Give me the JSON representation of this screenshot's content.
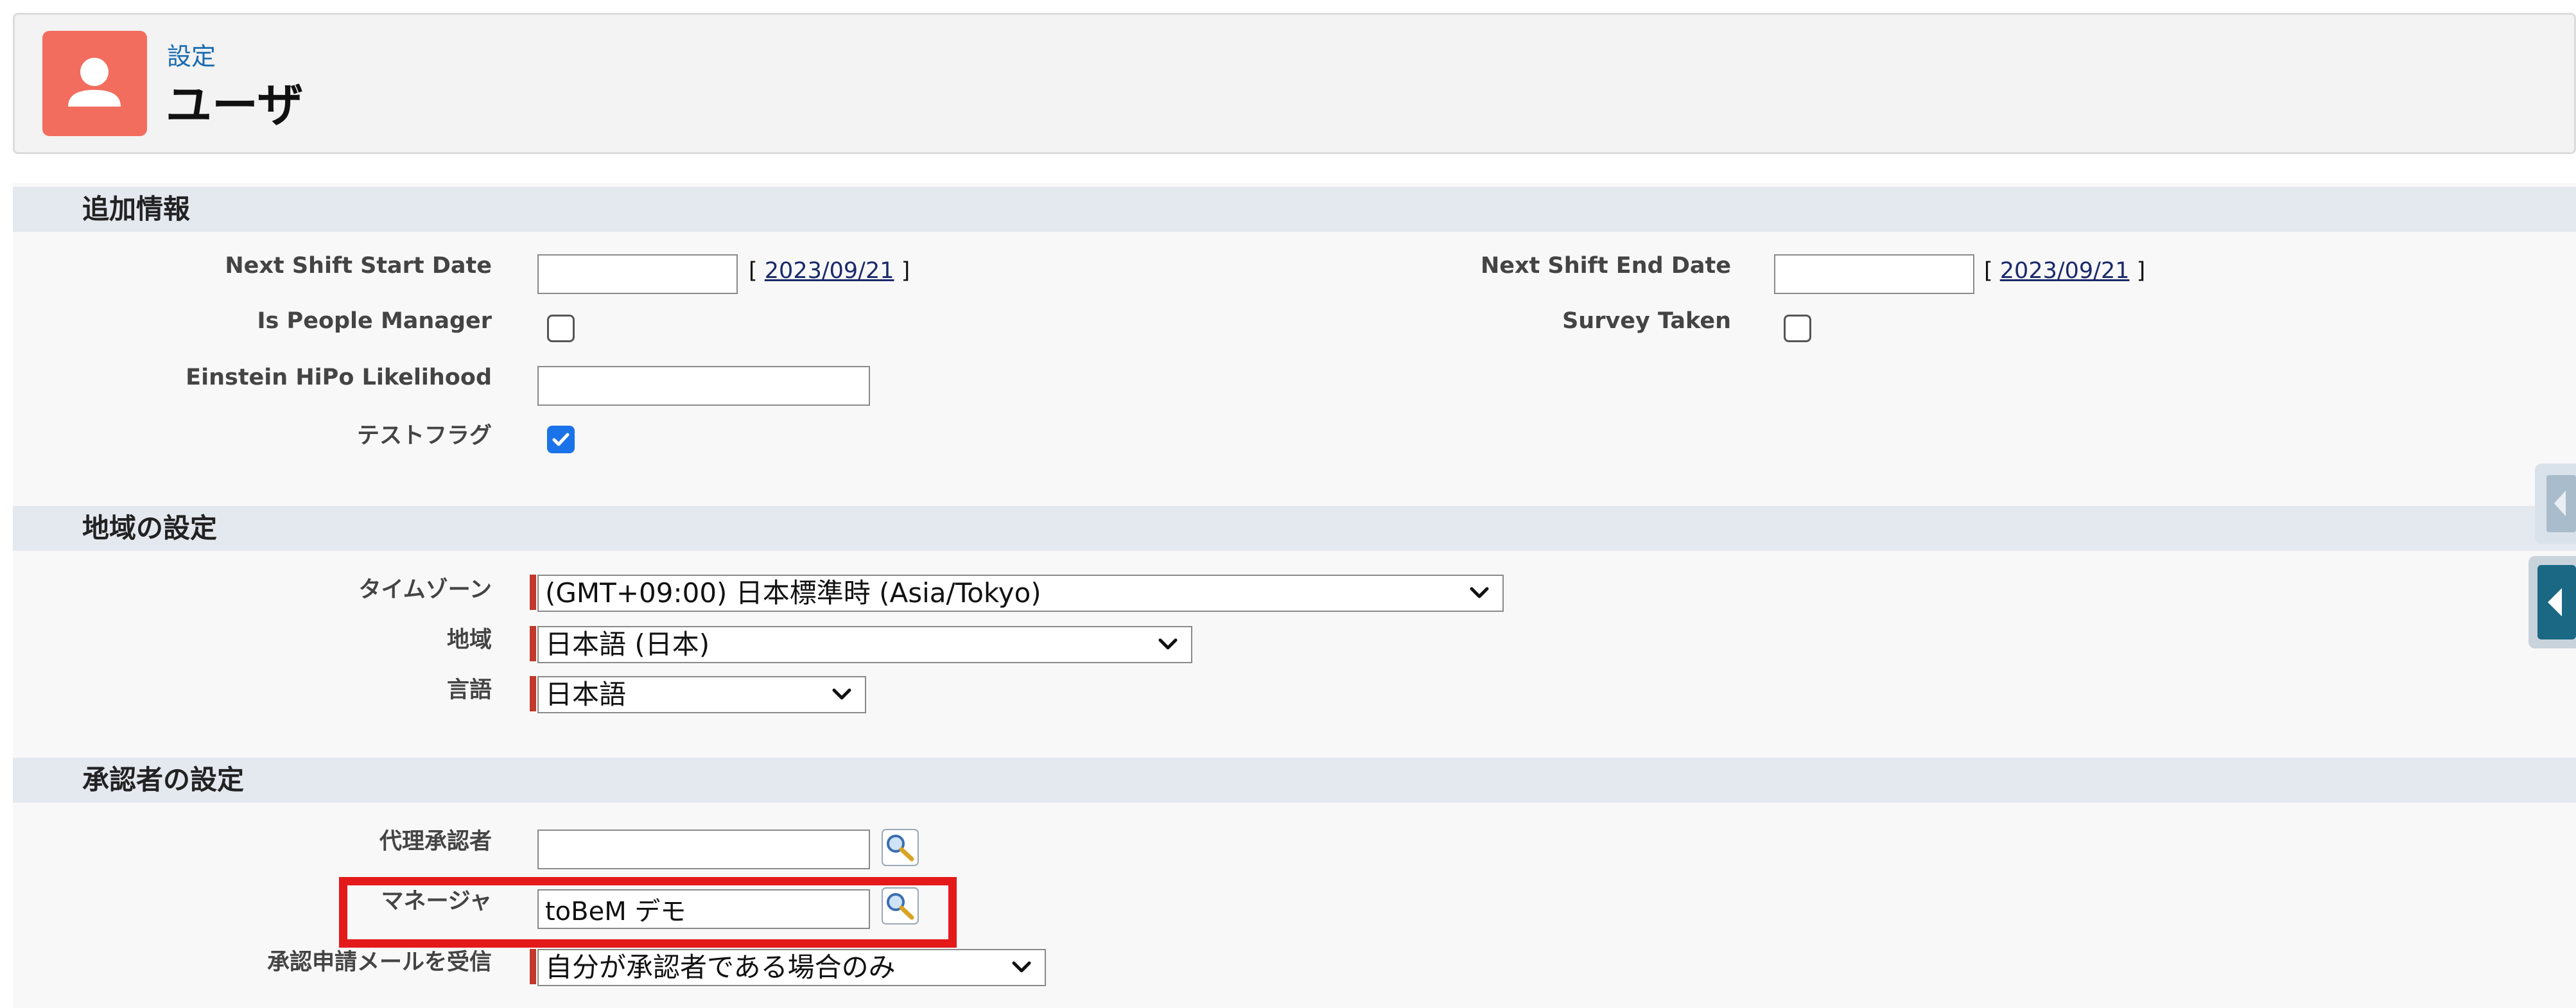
{
  "header": {
    "breadcrumb": "設定",
    "title": "ユーザ",
    "icon": "user-icon",
    "icon_color": "#f26d5e"
  },
  "sections": {
    "additional": {
      "title": "追加情報",
      "next_shift_start_label": "Next Shift Start Date",
      "next_shift_start_value": "",
      "next_shift_start_date": "2023/09/21",
      "next_shift_end_label": "Next Shift End Date",
      "next_shift_end_value": "",
      "next_shift_end_date": "2023/09/21",
      "people_manager_label": "Is People Manager",
      "people_manager_checked": false,
      "survey_taken_label": "Survey Taken",
      "survey_taken_checked": false,
      "hipo_label": "Einstein HiPo Likelihood",
      "hipo_value": "",
      "test_flag_label": "テストフラグ",
      "test_flag_checked": true
    },
    "locale": {
      "title": "地域の設定",
      "timezone_label": "タイムゾーン",
      "timezone_value": "(GMT+09:00) 日本標準時 (Asia/Tokyo)",
      "region_label": "地域",
      "region_value": "日本語 (日本)",
      "language_label": "言語",
      "language_value": "日本語"
    },
    "approver": {
      "title": "承認者の設定",
      "delegated_label": "代理承認者",
      "delegated_value": "",
      "manager_label": "マネージャ",
      "manager_value": "toBeM デモ",
      "email_label": "承認申請メールを受信",
      "email_value": "自分が承認者である場合のみ"
    }
  },
  "colors": {
    "section_bg": "#e4e8ef",
    "required": "#c0392b",
    "highlight": "#e3191a",
    "checkbox_checked": "#1a73e8"
  }
}
